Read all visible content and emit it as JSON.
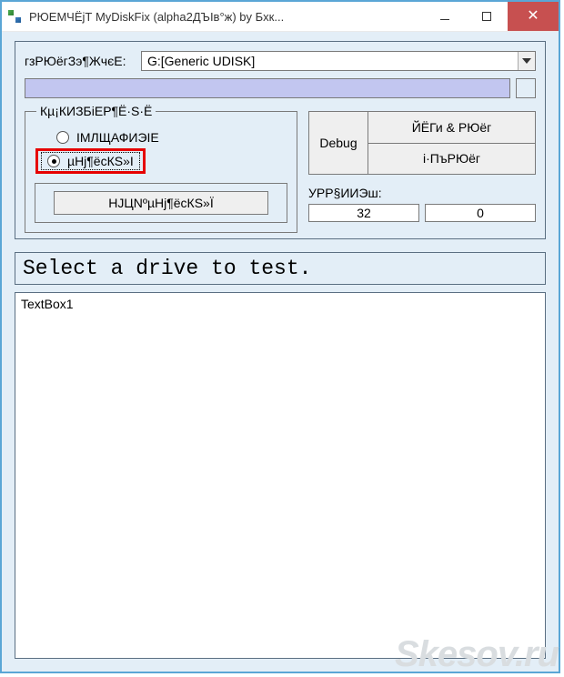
{
  "window": {
    "title": "РЮЕМЧЁjТ MyDiskFix (alpha2ДЪIв°ж) by Бхк..."
  },
  "drive": {
    "label": "гзРЮёгЗэ¶ЖчєE:",
    "selected": "G:[Generic UDISK]"
  },
  "modes": {
    "group_title": "Кµ¡КИЗБiЕР¶Ё·S·Ё",
    "option1": "IМЛЩАФИЭIЕ",
    "option2": "µНj¶ёсКS»I",
    "action_button": "НJЦNºµНj¶ёсКS»Ї"
  },
  "debug_block": {
    "debug_label": "Debug",
    "btn1": "ЙЁГи & РЮёг",
    "btn2": "i·ПъРЮёг"
  },
  "counters": {
    "label": "УРР§ИИЭш:",
    "val1": "32",
    "val2": "0"
  },
  "status_text": "Select a drive to test.",
  "log_text": "TextBox1",
  "watermark": "Skesov.ru"
}
